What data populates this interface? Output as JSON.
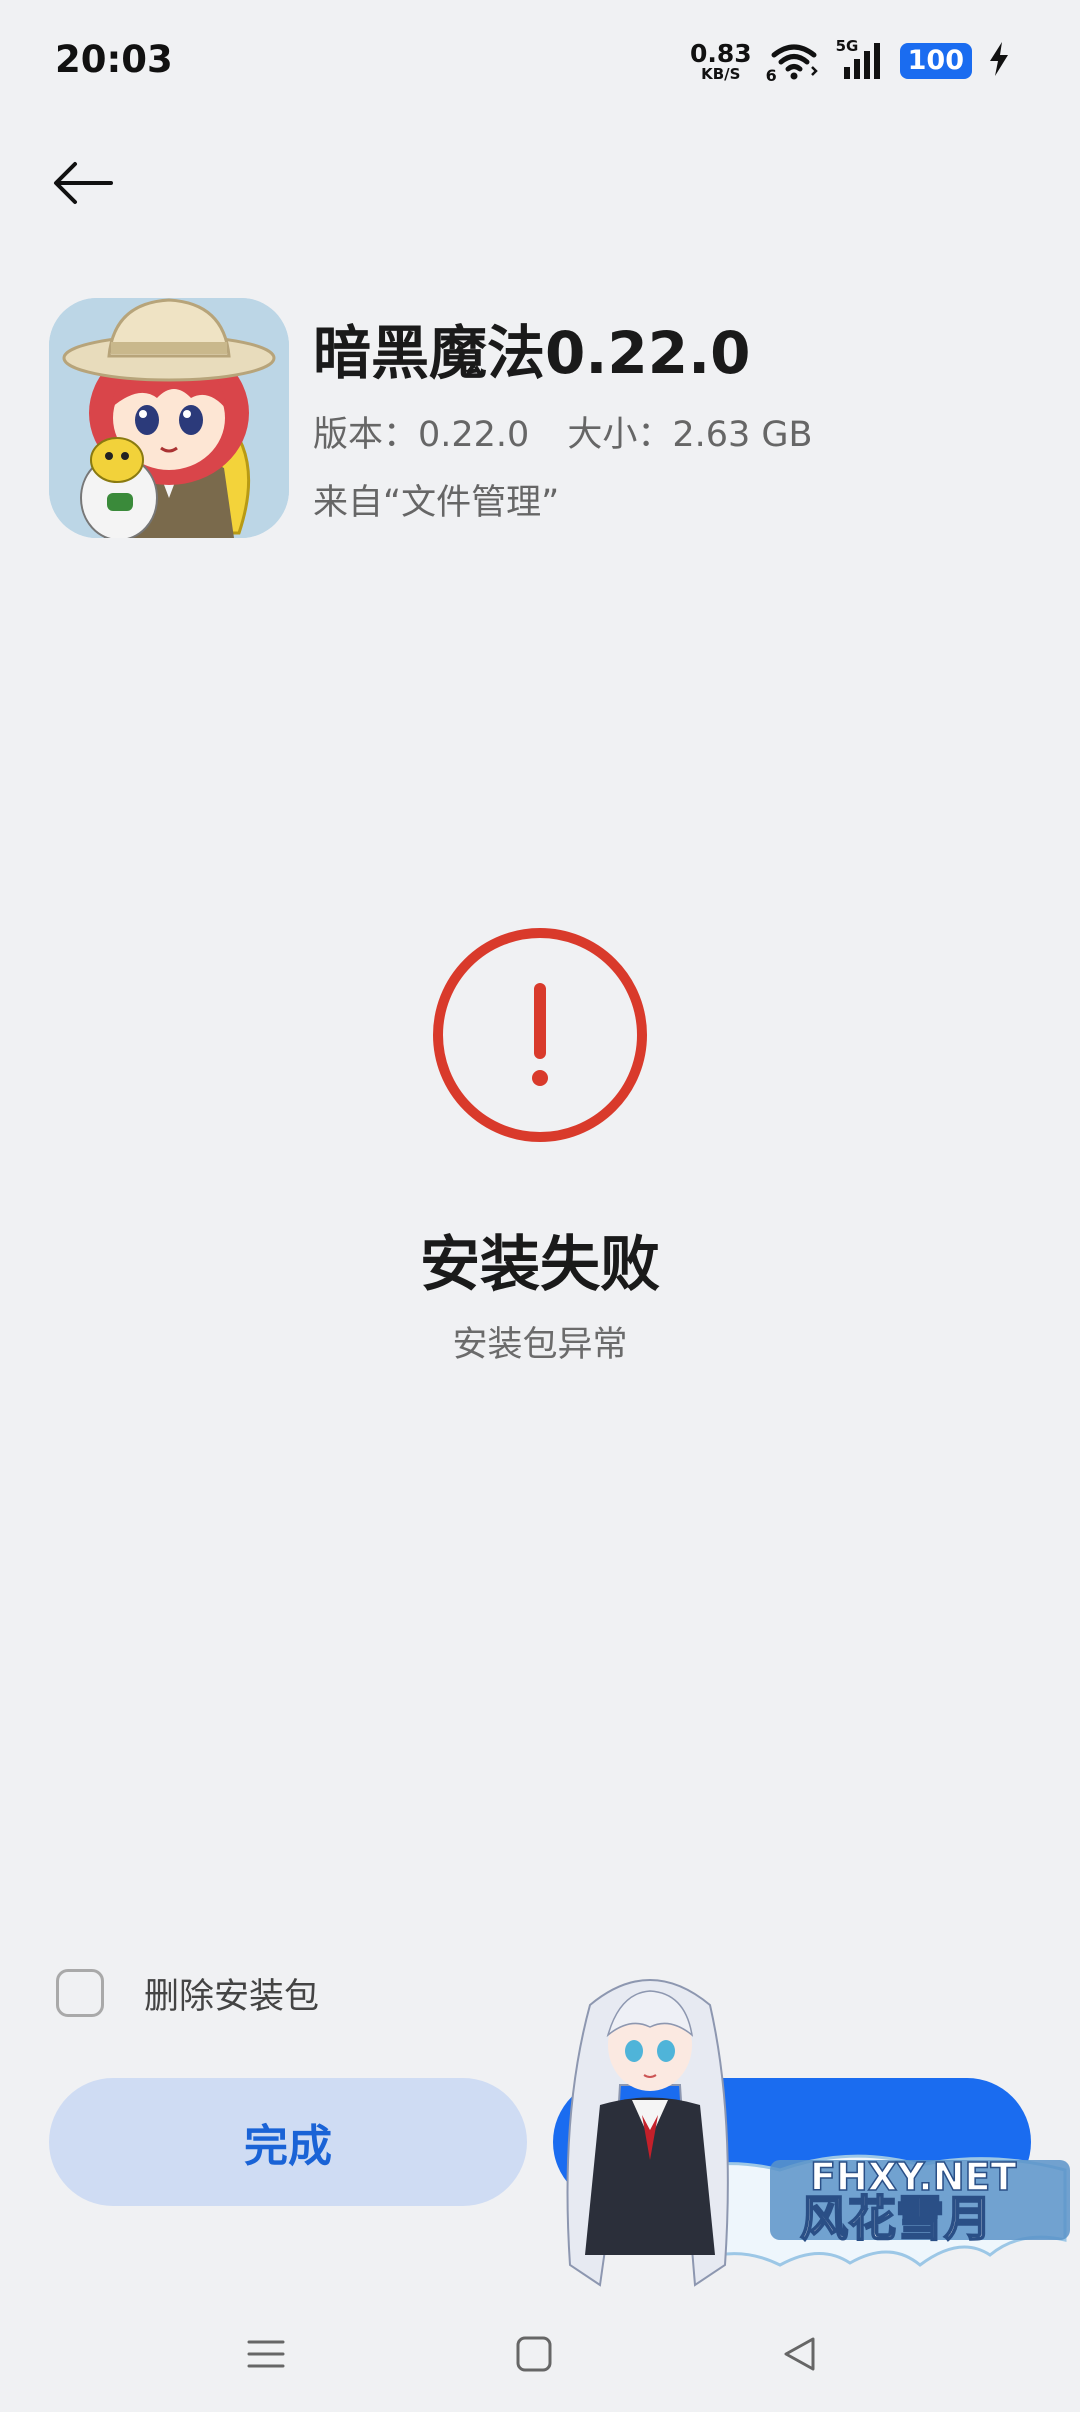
{
  "status_bar": {
    "time": "20:03",
    "net_speed_value": "0.83",
    "net_speed_unit": "KB/S",
    "wifi_badge": "6",
    "cell_label": "5G",
    "battery": "100",
    "icons": [
      "wifi-icon",
      "cellular-signal-icon",
      "battery-icon",
      "charging-bolt-icon"
    ]
  },
  "header": {
    "back_icon": "arrow-left-icon"
  },
  "app": {
    "title": "暗黑魔法0.22.0",
    "version": "版本：0.22.0",
    "size": "大小：2.63 GB",
    "source": "来自“文件管理”"
  },
  "result": {
    "icon": "exclamation-circle-icon",
    "title": "安装失败",
    "reason": "安装包异常",
    "accent_color": "#d93a2b"
  },
  "options": {
    "delete_package_label": "删除安装包",
    "delete_package_checked": false
  },
  "buttons": {
    "done_label": "完成",
    "primary_color": "#1a6cf0"
  },
  "watermark": {
    "site": "FHXY.NET",
    "text": "风花雪月"
  },
  "nav_bar": {
    "icons": [
      "menu-icon",
      "home-square-icon",
      "back-triangle-icon"
    ]
  }
}
